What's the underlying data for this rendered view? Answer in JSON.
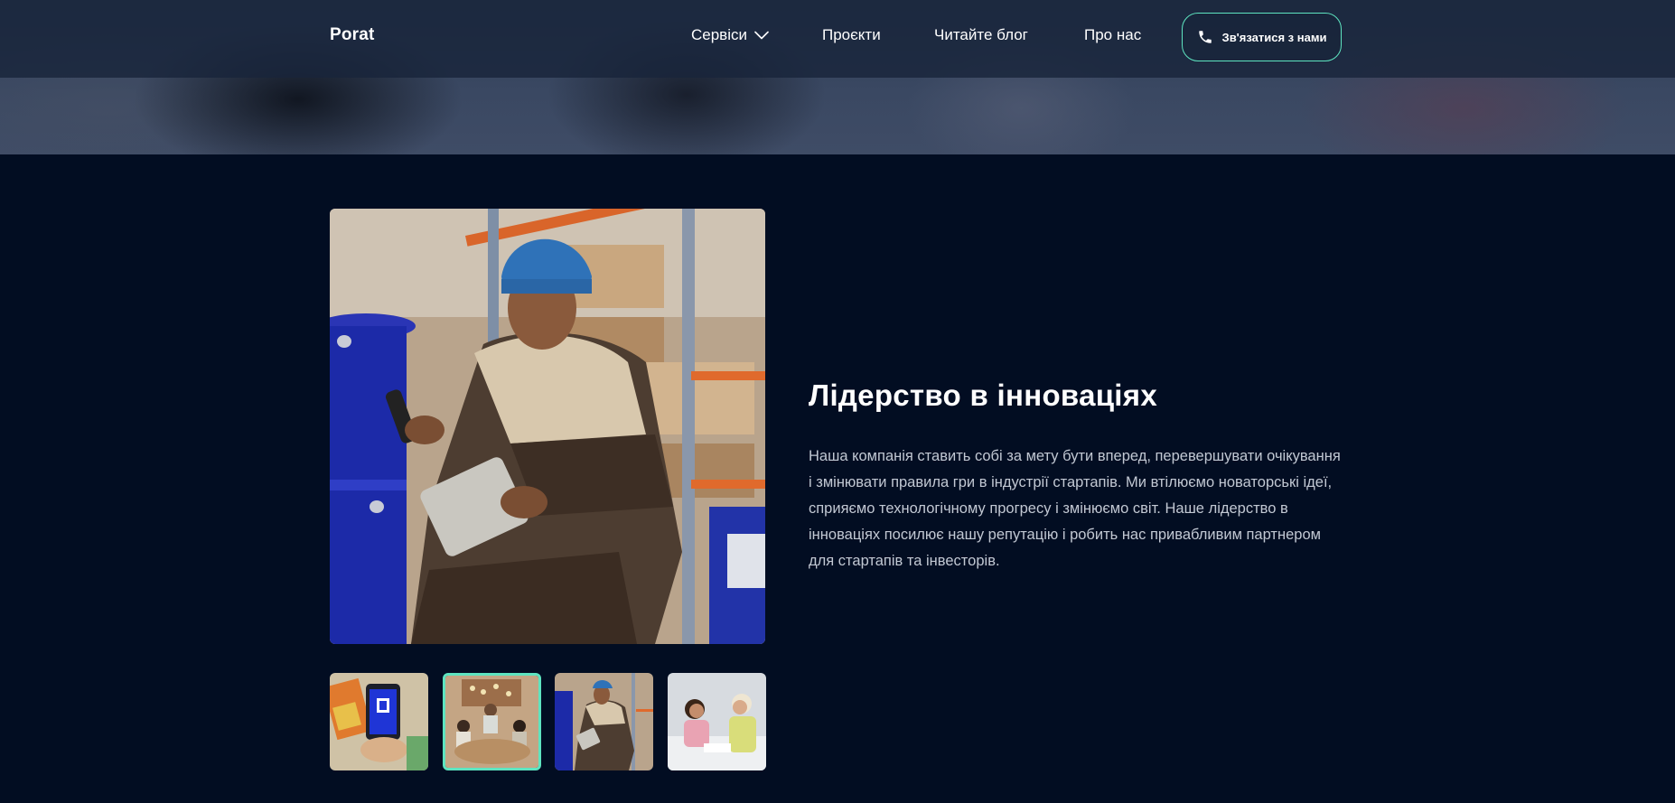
{
  "header": {
    "logo": "Porat",
    "nav": {
      "services": "Сервіси",
      "projects": "Проєкти",
      "blog": "Читайте блог",
      "about": "Про нас"
    },
    "contact_button": {
      "label": "Зв'язатися з нами",
      "icon": "phone-icon"
    }
  },
  "main": {
    "title": "Лідерство в інноваціях",
    "description": "Наша компанія ставить собі за мету бути вперед, перевершувати очікування і змінювати правила гри в індустрії стартапів. Ми втілюємо новаторські ідеї, сприяємо технологічному прогресу і змінюємо світ. Наше лідерство в інноваціях посилює нашу репутацію і робить нас привабливим партнером для стартапів та інвесторів.",
    "gallery": {
      "selected_index": 1,
      "thumbnail_count": 4
    }
  },
  "colors": {
    "background": "#020d22",
    "accent": "#5ee4c0",
    "text_muted": "#c2c8d3"
  }
}
